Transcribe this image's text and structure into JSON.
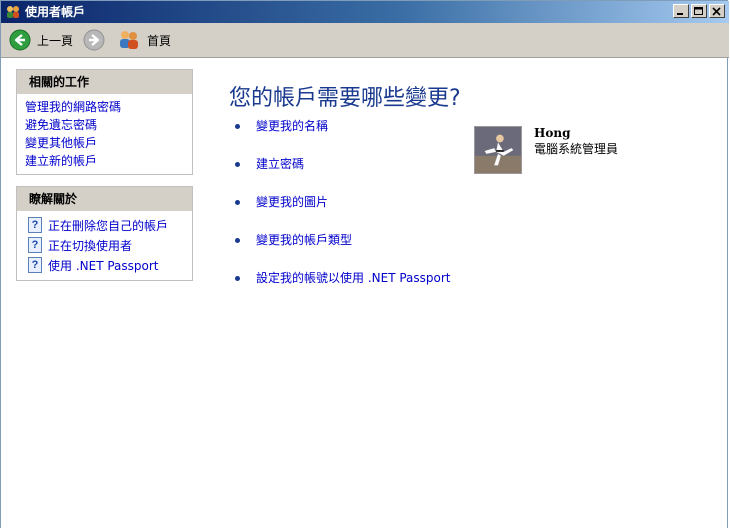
{
  "window": {
    "title": "使用者帳戶"
  },
  "toolbar": {
    "back_label": "上一頁",
    "home_label": "首頁"
  },
  "related_tasks": {
    "title": "相關的工作",
    "items": [
      {
        "label": "管理我的網路密碼"
      },
      {
        "label": "避免遺忘密碼"
      },
      {
        "label": "變更其他帳戶"
      },
      {
        "label": "建立新的帳戶"
      }
    ]
  },
  "learn_about": {
    "title": "瞭解關於",
    "items": [
      {
        "label": "正在刪除您自己的帳戶",
        "icon": "help-icon"
      },
      {
        "label": "正在切換使用者",
        "icon": "help-icon"
      },
      {
        "label": "使用 .NET Passport",
        "icon": "help-icon"
      }
    ]
  },
  "main": {
    "heading": "您的帳戶需要哪些變更?",
    "tasks": [
      {
        "label": "變更我的名稱"
      },
      {
        "label": "建立密碼"
      },
      {
        "label": "變更我的圖片"
      },
      {
        "label": "變更我的帳戶類型"
      },
      {
        "label": "設定我的帳號以使用 .NET Passport"
      }
    ]
  },
  "user": {
    "name": "Hong",
    "role": "電腦系統管理員"
  }
}
